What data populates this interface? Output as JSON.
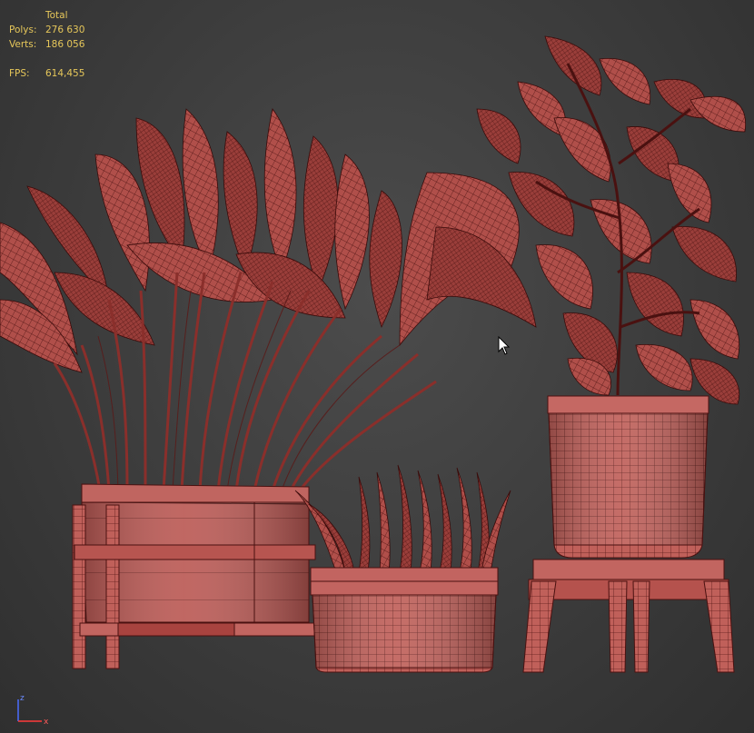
{
  "viewport": {
    "stats": {
      "total_label": "Total",
      "polys_label": "Polys:",
      "polys_value": "276 630",
      "verts_label": "Verts:",
      "verts_value": "186 056",
      "fps_label": "FPS:",
      "fps_value": "614,455"
    },
    "gizmo": {
      "z_label": "z",
      "x_label": "x"
    },
    "colors": {
      "background": "#3c3c3c",
      "stats_text": "#e6c75a",
      "mesh_fill": "#b4514c",
      "mesh_wire": "#4a1110"
    }
  }
}
